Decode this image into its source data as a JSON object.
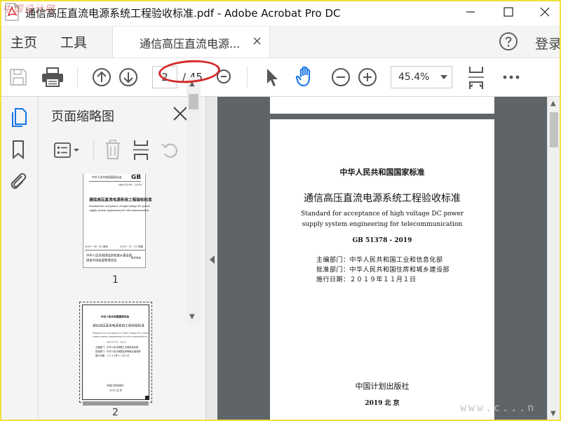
{
  "window": {
    "title": "通信高压直流电源系统工程验收标准.pdf - Adobe Acrobat Pro DC"
  },
  "menu": {
    "home": "主页",
    "tools": "工具",
    "doc_tab": "通信高压直流电源...",
    "tab_close": "×",
    "login": "登录"
  },
  "toolbar": {
    "page_current": "2",
    "page_total": "/ 45",
    "zoom": "45.4%"
  },
  "thumbnails_panel": {
    "title": "页面缩略图",
    "pages": [
      {
        "label": "1",
        "header_left": "中华人民共和国国家标准",
        "logo": "GB",
        "code": "GB 51378 - 2019",
        "title": "通信高压直流电源系统工程验收标准",
        "subtitle_en_1": "Standard for acceptance of high voltage DC power",
        "subtitle_en_2": "supply system engineering for telecommunication",
        "date_left": "2019 - 06 - 05 发布",
        "date_right": "2019 - 11 - 01 实施",
        "issuer_1": "中华人民共和国住房和城乡建设部",
        "issuer_2": "国家市场监督管理总局",
        "issuer_suffix": "联合发布"
      },
      {
        "label": "2"
      }
    ]
  },
  "document": {
    "heading": "中华人民共和国国家标准",
    "title": "通信高压直流电源系统工程验收标准",
    "english_1": "Standard for acceptance of high voltage DC power",
    "english_2": "supply system engineering for telecommunication",
    "code": "GB 51378 - 2019",
    "editor": "主编部门：中华人民共和国工业和信息化部",
    "approver": "批准部门：中华人民共和国住房和城乡建设部",
    "effective": "施行日期：２０１９年１１月１日",
    "publisher": "中国计划出版社",
    "pub_year": "2019  北  京"
  },
  "watermarks": {
    "top_left": "中国设计网",
    "bottom_right": "www.c...n"
  },
  "colors": {
    "accent_blue": "#1473e6",
    "annotation_red": "#d42a2a",
    "doc_background": "#5f6468",
    "frame_yellow": "#f0e03a"
  }
}
